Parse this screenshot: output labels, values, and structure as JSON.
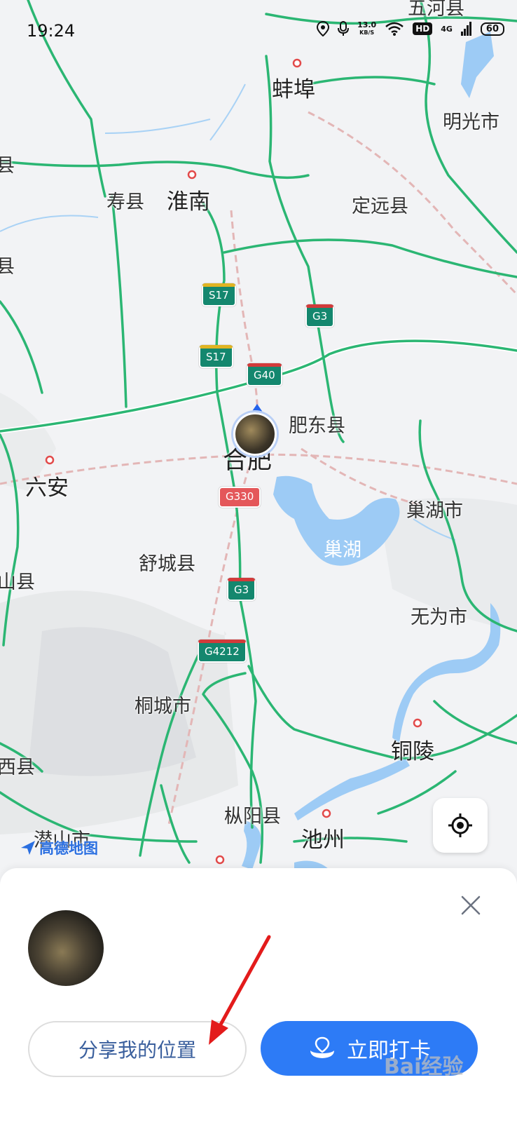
{
  "status_bar": {
    "time": "19:24",
    "net_speed_value": "13.0",
    "net_speed_unit": "KB/S",
    "hd": "HD",
    "signal": "4G",
    "battery": "60"
  },
  "map": {
    "cities": [
      {
        "name": "五河县"
      },
      {
        "name": "蚌埠"
      },
      {
        "name": "明光市"
      },
      {
        "name": "寿县"
      },
      {
        "name": "淮南"
      },
      {
        "name": "定远县"
      },
      {
        "name": "肥东县"
      },
      {
        "name": "合肥"
      },
      {
        "name": "六安"
      },
      {
        "name": "巢湖市"
      },
      {
        "name": "舒城县"
      },
      {
        "name": "无为市"
      },
      {
        "name": "桐城市"
      },
      {
        "name": "铜陵"
      },
      {
        "name": "枞阳县"
      },
      {
        "name": "池州"
      },
      {
        "name": "潜山市"
      },
      {
        "name": "县"
      },
      {
        "name": "县"
      },
      {
        "name": "山县"
      },
      {
        "name": "西县"
      }
    ],
    "lake_label": "巢湖",
    "road_shields": [
      "S17",
      "G3",
      "S17",
      "G40",
      "G330",
      "G3",
      "G4212"
    ],
    "brand": "高德地图",
    "colors": {
      "highway": "#2bb673",
      "water": "#9dcbf5",
      "land": "#f2f3f5",
      "rail": "#e3b6b6"
    }
  },
  "sheet": {
    "share_button_label": "分享我的位置",
    "checkin_button_label": "立即打卡",
    "close_icon": "close-icon",
    "watermark": "Bai经验"
  }
}
